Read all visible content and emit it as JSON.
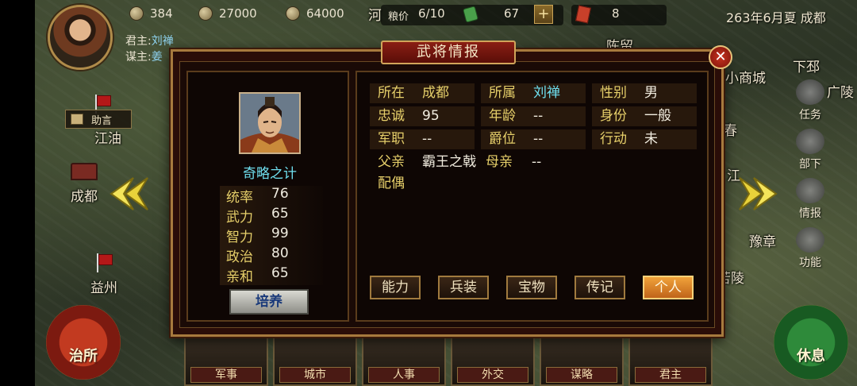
{
  "top_bar": {
    "res1": "384",
    "res2": "27000",
    "res3": "64000",
    "grain_label": "粮价",
    "grain_price": "6/10",
    "jade": "67",
    "plus": "+",
    "orders": "8",
    "date": "263年6月夏 成都"
  },
  "lord": {
    "lord_label": "君主:",
    "lord_name": "刘禅",
    "advisor_label": "谋主:",
    "advisor_name": "姜"
  },
  "advice_label": "助言",
  "map_cities": {
    "jiangyou": "江油",
    "chengdu": "成都",
    "yizhou": "益州",
    "chenliu": "陈留",
    "xiaoshang": "小商城",
    "xiapi": "下邳",
    "guangling": "广陵",
    "yuzhang": "豫章",
    "hanei": "河",
    "chun": "春",
    "jiang": "江",
    "lingling": "苦陵"
  },
  "right_menu": [
    "任务",
    "部下",
    "情报",
    "功能"
  ],
  "bottom": {
    "left_round": "治所",
    "right_round": "休息",
    "tabs": [
      "军事",
      "城市",
      "人事",
      "外交",
      "谋略",
      "君主"
    ]
  },
  "dialog": {
    "title": "武将情报",
    "close": "✕",
    "strategy": "奇略之计",
    "stats": [
      {
        "k": "统率",
        "v": "76"
      },
      {
        "k": "武力",
        "v": "65"
      },
      {
        "k": "智力",
        "v": "99"
      },
      {
        "k": "政治",
        "v": "80"
      },
      {
        "k": "亲和",
        "v": "65"
      }
    ],
    "train": "培养",
    "info": {
      "location_k": "所在",
      "location_v": "成都",
      "affiliation_k": "所属",
      "affiliation_v": "刘禅",
      "gender_k": "性别",
      "gender_v": "男",
      "loyalty_k": "忠诚",
      "loyalty_v": "95",
      "age_k": "年龄",
      "age_v": "--",
      "status_k": "身份",
      "status_v": "一般",
      "position_k": "军职",
      "position_v": "--",
      "rank_k": "爵位",
      "rank_v": "--",
      "action_k": "行动",
      "action_v": "未",
      "father_k": "父亲",
      "father_v": "霸王之戟",
      "mother_k": "母亲",
      "mother_v": "--",
      "spouse_k": "配偶"
    },
    "tabs": [
      "能力",
      "兵装",
      "宝物",
      "传记",
      "个人"
    ],
    "active_tab": "个人"
  },
  "colors": {
    "accent_gold": "#e6cf6a",
    "accent_cyan": "#6fe0f0",
    "frame": "#a77a3e",
    "active_tab": "#e88a2a"
  }
}
